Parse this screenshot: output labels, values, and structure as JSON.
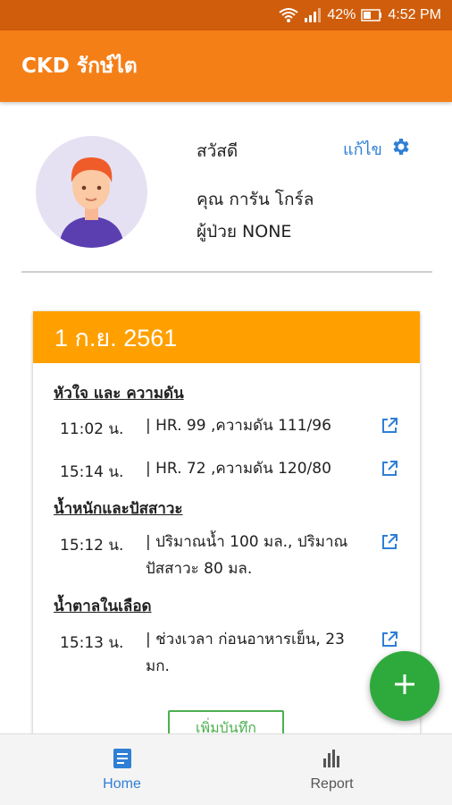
{
  "status_bar": {
    "battery": "42%",
    "time": "4:52 PM"
  },
  "app_bar": {
    "title": "CKD รักษ์ไต"
  },
  "profile": {
    "greeting": "สวัสดี",
    "name": "คุณ การัน โกร์ล",
    "patient_id": "ผู้ป่วย NONE",
    "edit_label": "แก้ไข"
  },
  "card": {
    "date": "1 ก.ย. 2561",
    "sections": [
      {
        "title": "หัวใจ และ ความดัน",
        "entries": [
          {
            "time": "11:02 น.",
            "text": "| HR. 99 ,ความดัน 111/96"
          },
          {
            "time": "15:14 น.",
            "text": "| HR. 72 ,ความดัน 120/80"
          }
        ]
      },
      {
        "title": "น้ำหนักและปัสสาวะ",
        "entries": [
          {
            "time": "15:12 น.",
            "text": "| ปริมาณน้ำ 100 มล., ปริมาณปัสสาวะ 80 มล."
          }
        ]
      },
      {
        "title": "น้ำตาลในเลือด",
        "entries": [
          {
            "time": "15:13 น.",
            "text": "| ช่วงเวลา ก่อนอาหารเย็น, 23 มก."
          }
        ]
      }
    ],
    "add_button_label": "เพิ่มบันทึก"
  },
  "bottom_nav": {
    "items": [
      {
        "label": "Home",
        "icon": "list-icon",
        "active": true
      },
      {
        "label": "Report",
        "icon": "bar-chart-icon",
        "active": false
      }
    ]
  },
  "colors": {
    "status_bar": "#cf5d0c",
    "app_bar": "#f57f17",
    "card_header": "#ffa000",
    "accent_blue": "#2f7fd6",
    "fab_green": "#2eaa3c"
  }
}
